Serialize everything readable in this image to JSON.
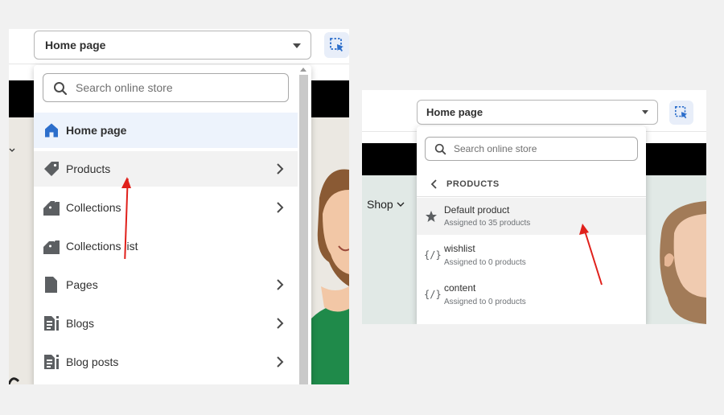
{
  "left": {
    "page_selector": "Home page",
    "search_placeholder": "Search online store",
    "menu": [
      {
        "label": "Home page",
        "icon": "home-icon",
        "has_submenu": false,
        "state": "selected"
      },
      {
        "label": "Products",
        "icon": "tag-icon",
        "has_submenu": true,
        "state": "hover"
      },
      {
        "label": "Collections",
        "icon": "collection-icon",
        "has_submenu": true,
        "state": "normal"
      },
      {
        "label": "Collections list",
        "icon": "collection-icon",
        "has_submenu": false,
        "state": "normal"
      },
      {
        "label": "Pages",
        "icon": "page-icon",
        "has_submenu": true,
        "state": "normal"
      },
      {
        "label": "Blogs",
        "icon": "blog-icon",
        "has_submenu": true,
        "state": "normal"
      },
      {
        "label": "Blog posts",
        "icon": "blog-icon",
        "has_submenu": true,
        "state": "normal"
      }
    ]
  },
  "right": {
    "page_selector": "Home page",
    "search_placeholder": "Search online store",
    "back_label": "PRODUCTS",
    "storefront_nav": "Shop",
    "templates": [
      {
        "name": "Default product",
        "subtitle": "Assigned to 35 products",
        "icon": "star-icon",
        "state": "hover"
      },
      {
        "name": "wishlist",
        "subtitle": "Assigned to 0 products",
        "icon": "code-icon",
        "state": "normal"
      },
      {
        "name": "content",
        "subtitle": "Assigned to 0 products",
        "icon": "code-icon",
        "state": "normal"
      }
    ]
  },
  "colors": {
    "selected_bg": "#edf3fc",
    "hover_bg": "#f2f2f2",
    "home_icon": "#2c6ecb",
    "annotation_arrow": "#e0201b",
    "scrollbar": "#c9c9c9"
  }
}
